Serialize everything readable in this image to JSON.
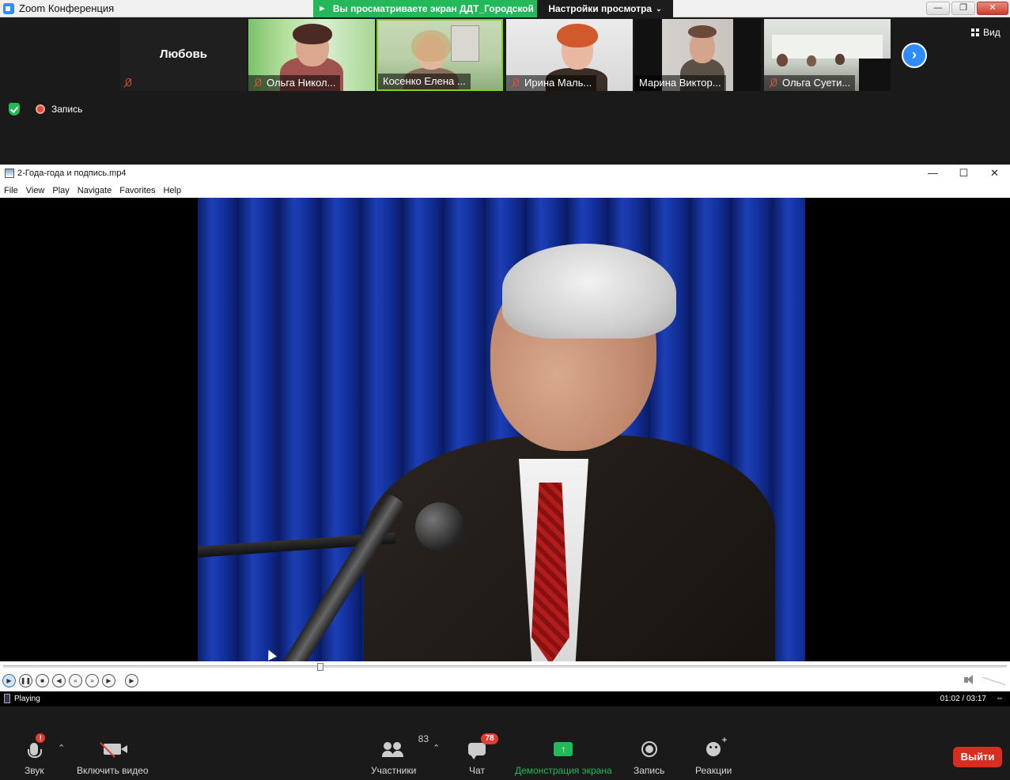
{
  "zoom": {
    "title": "Zoom Конференция",
    "share_banner": "Вы просматриваете экран ДДТ_Городской",
    "view_settings": "Настройки просмотра",
    "view_button": "Вид",
    "recording_label": "Запись"
  },
  "participants": [
    {
      "name": "Любовь",
      "muted": true
    },
    {
      "name": "Ольга Никол...",
      "muted": true
    },
    {
      "name": "Косенко Елена ...",
      "muted": false,
      "active": true
    },
    {
      "name": "Ирина Маль...",
      "muted": true
    },
    {
      "name": "Марина Виктор...",
      "muted": false
    },
    {
      "name": "Ольга Суети...",
      "muted": true
    }
  ],
  "player": {
    "title": "2-Года-года и подпись.mp4",
    "menu": [
      "File",
      "View",
      "Play",
      "Navigate",
      "Favorites",
      "Help"
    ],
    "status": "Playing",
    "time": "01:02 / 03:17",
    "progress_fraction": 0.316
  },
  "toolbar": {
    "audio": "Звук",
    "video": "Включить видео",
    "participants": "Участники",
    "participants_count": "83",
    "chat": "Чат",
    "chat_badge": "78",
    "share": "Демонстрация экрана",
    "record": "Запись",
    "reactions": "Реакции",
    "leave": "Выйти"
  },
  "colors": {
    "accent_green": "#23b85a",
    "zoom_blue": "#2d8cff",
    "leave_red": "#d92d20"
  }
}
